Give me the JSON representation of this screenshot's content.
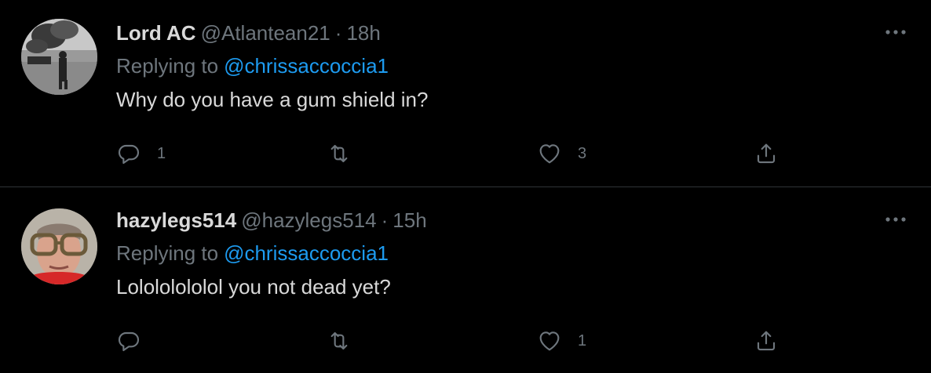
{
  "colors": {
    "background": "#000000",
    "primary_text": "#d9d9d9",
    "secondary_text": "#6e767d",
    "link": "#1d9bf0",
    "divider": "#2f3336"
  },
  "tweets": [
    {
      "display_name": "Lord AC",
      "handle": "@Atlantean21",
      "separator": "·",
      "time": "18h",
      "replying_to_label": "Replying to",
      "replying_to_handle": "@chrissaccoccia1",
      "text": "Why do you have a gum shield in?",
      "avatar_icon": "avatar-photo-soldier",
      "actions": {
        "reply_count": "1",
        "retweet_count": "",
        "like_count": "3"
      }
    },
    {
      "display_name": "hazylegs514",
      "handle": "@hazylegs514",
      "separator": "·",
      "time": "15h",
      "replying_to_label": "Replying to",
      "replying_to_handle": "@chrissaccoccia1",
      "text": "Lolololololol you not dead yet?",
      "avatar_icon": "avatar-photo-man-glasses",
      "actions": {
        "reply_count": "",
        "retweet_count": "",
        "like_count": "1"
      }
    }
  ]
}
